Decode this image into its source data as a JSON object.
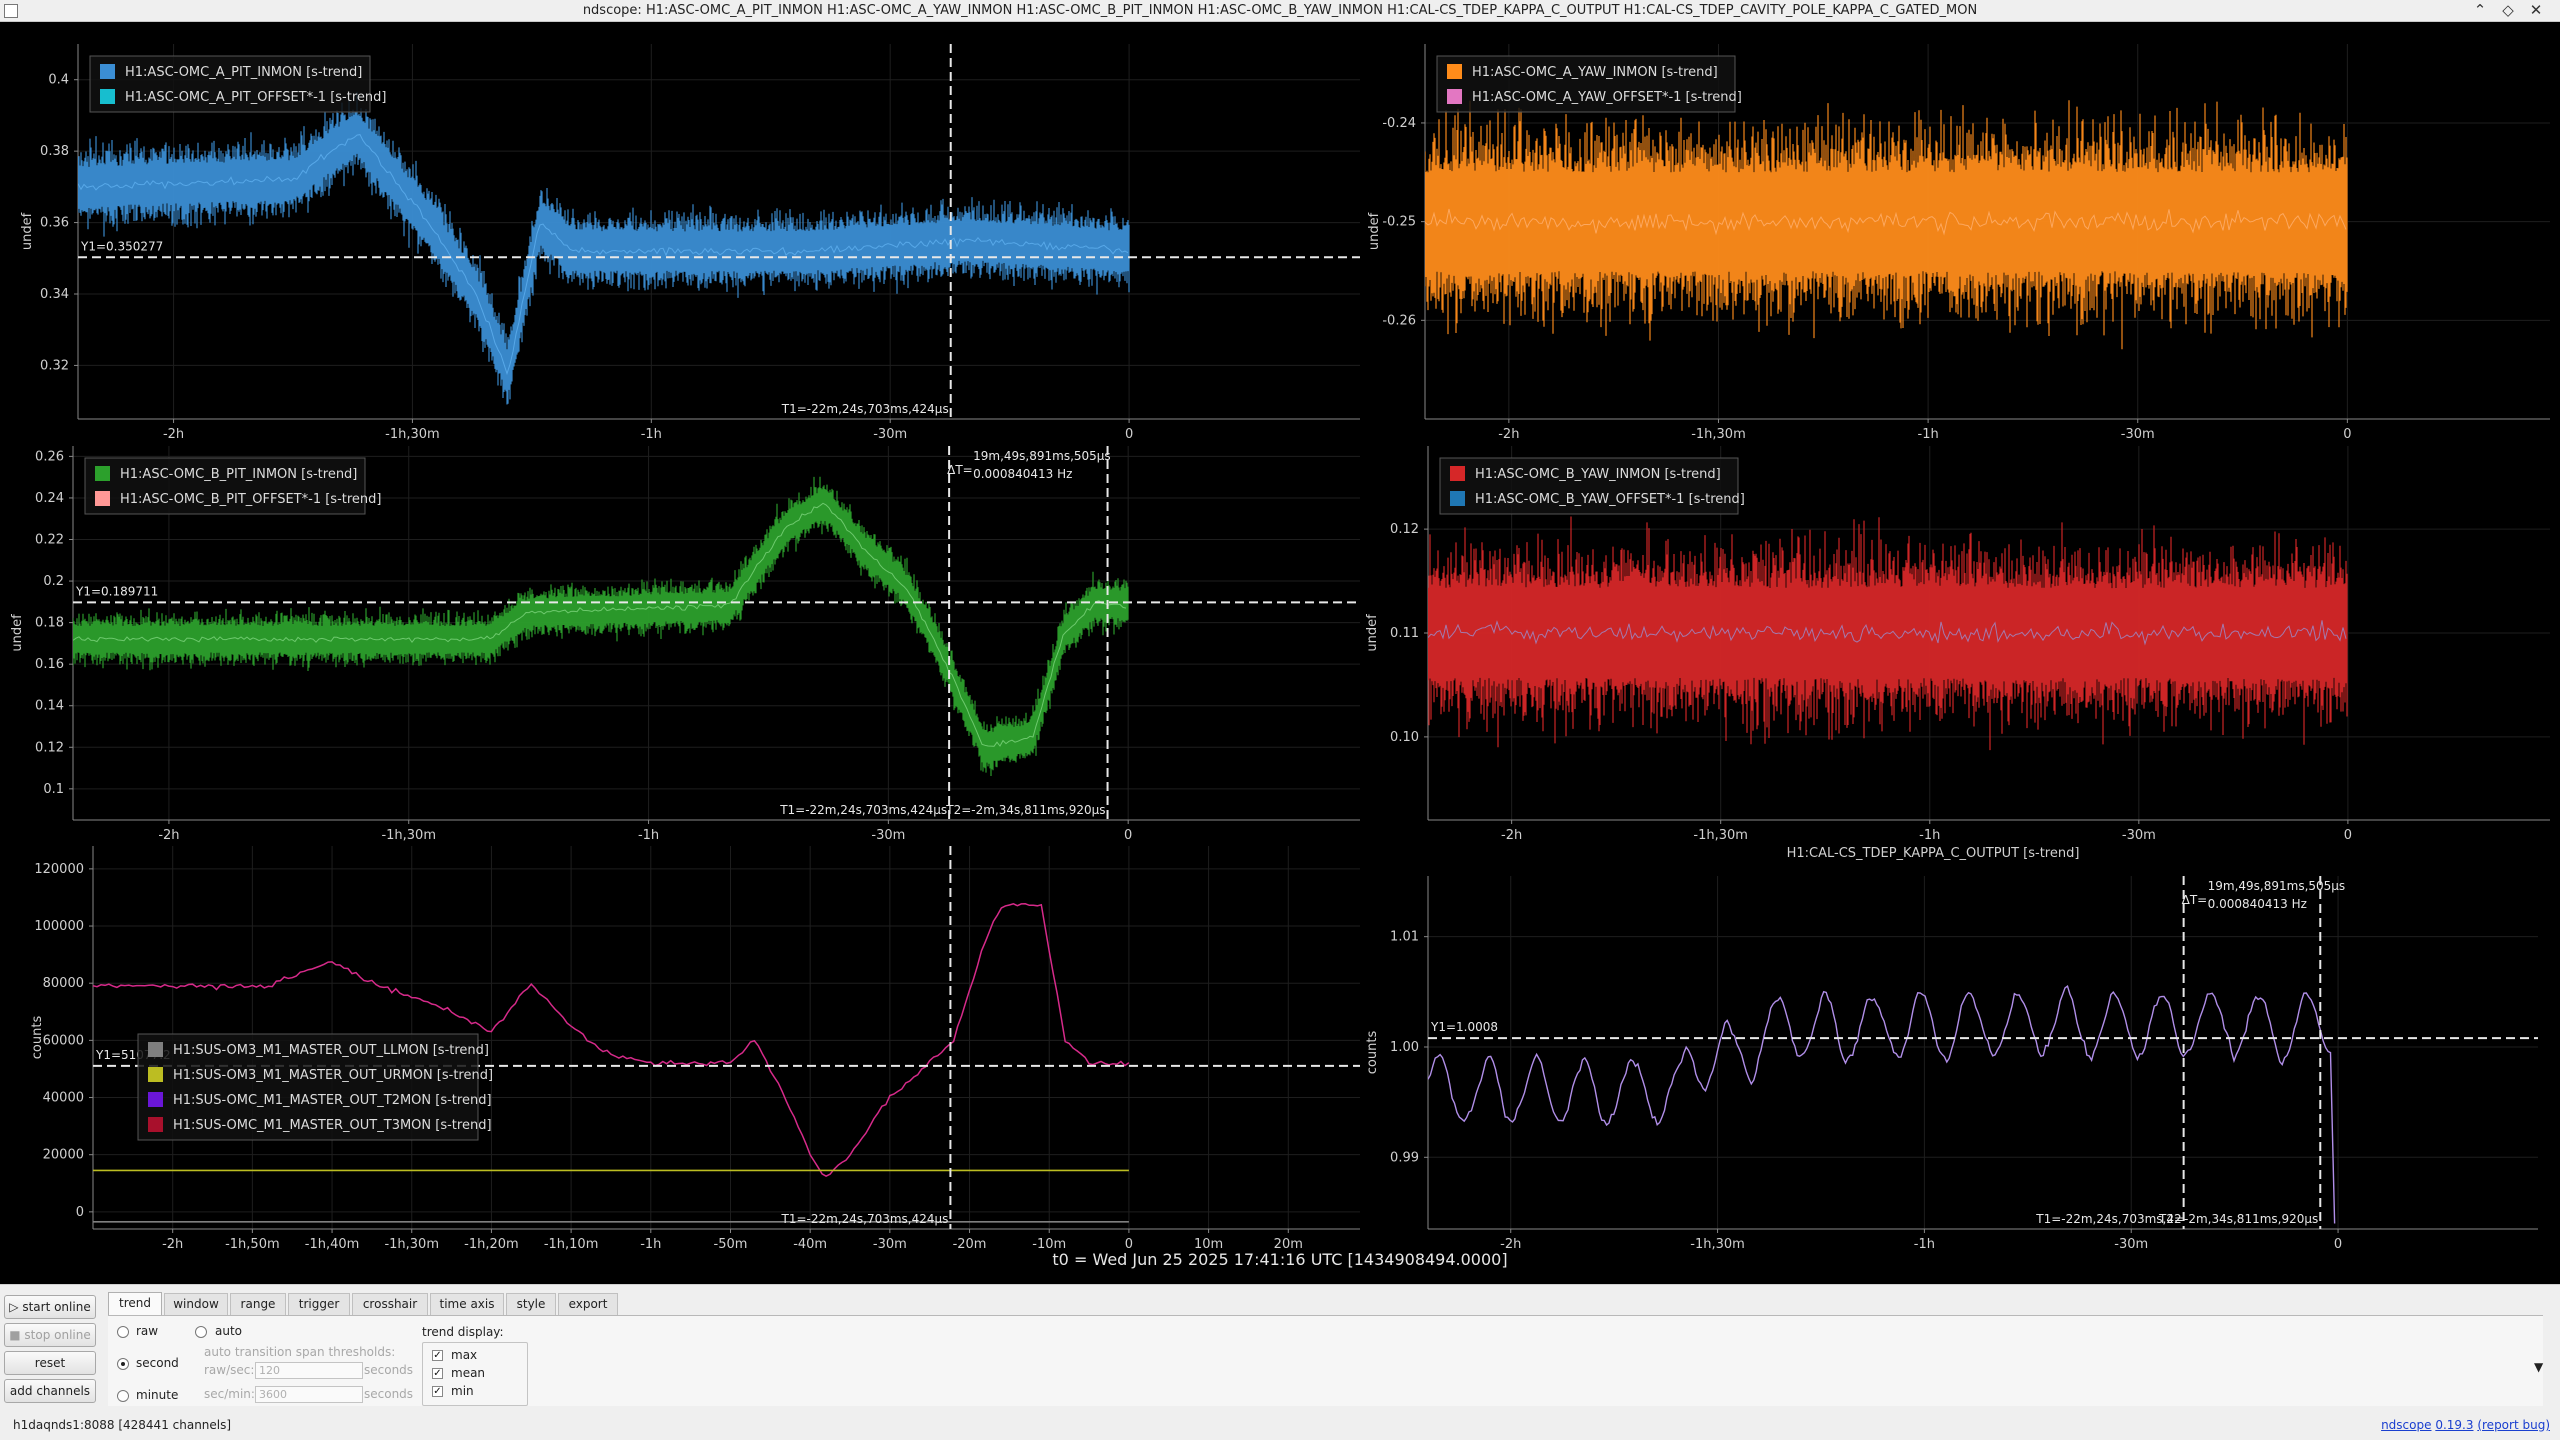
{
  "window": {
    "title": "ndscope: H1:ASC-OMC_A_PIT_INMON H1:ASC-OMC_A_YAW_INMON H1:ASC-OMC_B_PIT_INMON H1:ASC-OMC_B_YAW_INMON H1:CAL-CS_TDEP_KAPPA_C_OUTPUT H1:CAL-CS_TDEP_CAVITY_POLE_KAPPA_C_GATED_MON"
  },
  "colors": {
    "blue": "#3b8ed4",
    "cyan": "#17becf",
    "orange": "#ff8c1a",
    "pink": "#e377c2",
    "green": "#2ca02c",
    "salmon": "#ff9896",
    "red": "#d62728",
    "steelblue": "#1f77b4",
    "gray": "#7f7f7f",
    "olive": "#bcbd22",
    "purple": "#6a16d8",
    "crimson": "#a8102c",
    "lavender": "#b08ee8",
    "magenta": "#d62a8a"
  },
  "plots": [
    {
      "id": "a-pit",
      "ylabel": "undef",
      "yticks": [
        "0.4",
        "0.38",
        "0.36",
        "0.34",
        "0.32"
      ],
      "ytick_vals": [
        0.4,
        0.38,
        0.36,
        0.34,
        0.32
      ],
      "ylim": [
        0.305,
        0.41
      ],
      "xticks": [
        "-2h",
        "-1h,30m",
        "-1h",
        "-30m",
        "0"
      ],
      "xtick_vals": [
        -120,
        -90,
        -60,
        -30,
        0
      ],
      "xlim": [
        -132,
        29
      ],
      "legend": [
        {
          "name": "H1:ASC-OMC_A_PIT_INMON [s-trend]",
          "color": "#3b8ed4"
        },
        {
          "name": "H1:ASC-OMC_A_PIT_OFFSET*-1 [s-trend]",
          "color": "#17becf"
        }
      ],
      "y1": {
        "label": "Y1=0.350277",
        "value": 0.350277
      },
      "t1": {
        "label": "T1=-22m,24s,703ms,424µs",
        "value": -22.4
      }
    },
    {
      "id": "a-yaw",
      "ylabel": "undef",
      "yticks": [
        "-0.24",
        "-0.25",
        "-0.26"
      ],
      "ytick_vals": [
        -0.24,
        -0.25,
        -0.26
      ],
      "ylim": [
        -0.27,
        -0.232
      ],
      "xticks": [
        "-2h",
        "-1h,30m",
        "-1h",
        "-30m",
        "0"
      ],
      "xtick_vals": [
        -120,
        -90,
        -60,
        -30,
        0
      ],
      "xlim": [
        -132,
        29
      ],
      "legend": [
        {
          "name": "H1:ASC-OMC_A_YAW_INMON [s-trend]",
          "color": "#ff8c1a"
        },
        {
          "name": "H1:ASC-OMC_A_YAW_OFFSET*-1 [s-trend]",
          "color": "#e377c2"
        }
      ]
    },
    {
      "id": "b-pit",
      "ylabel": "undef",
      "yticks": [
        "0.26",
        "0.24",
        "0.22",
        "0.2",
        "0.18",
        "0.16",
        "0.14",
        "0.12",
        "0.1"
      ],
      "ytick_vals": [
        0.26,
        0.24,
        0.22,
        0.2,
        0.18,
        0.16,
        0.14,
        0.12,
        0.1
      ],
      "ylim": [
        0.085,
        0.265
      ],
      "xticks": [
        "-2h",
        "-1h,30m",
        "-1h",
        "-30m",
        "0"
      ],
      "xtick_vals": [
        -120,
        -90,
        -60,
        -30,
        0
      ],
      "xlim": [
        -132,
        29
      ],
      "legend": [
        {
          "name": "H1:ASC-OMC_B_PIT_INMON [s-trend]",
          "color": "#2ca02c"
        },
        {
          "name": "H1:ASC-OMC_B_PIT_OFFSET*-1 [s-trend]",
          "color": "#ff9896"
        }
      ],
      "y1": {
        "label": "Y1=0.189711",
        "value": 0.189711
      },
      "t1": {
        "label": "T1=-22m,24s,703ms,424µs",
        "value": -22.4
      },
      "t2": {
        "label": "T2=-2m,34s,811ms,920µs",
        "value": -2.58
      },
      "delta": {
        "label": "ΔT=",
        "value": "19m,49s,891ms,505µs",
        "freq": "0.000840413 Hz"
      }
    },
    {
      "id": "b-yaw",
      "ylabel": "undef",
      "yticks": [
        "0.12",
        "0.11",
        "0.10"
      ],
      "ytick_vals": [
        0.12,
        0.11,
        0.1
      ],
      "ylim": [
        0.092,
        0.128
      ],
      "xticks": [
        "-2h",
        "-1h,30m",
        "-1h",
        "-30m",
        "0"
      ],
      "xtick_vals": [
        -120,
        -90,
        -60,
        -30,
        0
      ],
      "xlim": [
        -132,
        29
      ],
      "legend": [
        {
          "name": "H1:ASC-OMC_B_YAW_INMON [s-trend]",
          "color": "#d62728"
        },
        {
          "name": "H1:ASC-OMC_B_YAW_OFFSET*-1 [s-trend]",
          "color": "#1f77b4"
        }
      ]
    },
    {
      "id": "sus",
      "ylabel": "counts",
      "yticks": [
        "120000",
        "100000",
        "80000",
        "60000",
        "40000",
        "20000",
        "0"
      ],
      "ytick_vals": [
        120000,
        100000,
        80000,
        60000,
        40000,
        20000,
        0
      ],
      "ylim": [
        -6000,
        128000
      ],
      "xticks": [
        "-2h",
        "-1h,50m",
        "-1h,40m",
        "-1h,30m",
        "-1h,20m",
        "-1h,10m",
        "-1h",
        "-50m",
        "-40m",
        "-30m",
        "-20m",
        "-10m",
        "0",
        "10m",
        "20m"
      ],
      "xtick_vals": [
        -120,
        -110,
        -100,
        -90,
        -80,
        -70,
        -60,
        -50,
        -40,
        -30,
        -20,
        -10,
        0,
        10,
        20
      ],
      "xlim": [
        -130,
        29
      ],
      "legend": [
        {
          "name": "H1:SUS-OM3_M1_MASTER_OUT_LLMON [s-trend]",
          "color": "#7f7f7f"
        },
        {
          "name": "H1:SUS-OM3_M1_MASTER_OUT_URMON [s-trend]",
          "color": "#bcbd22"
        },
        {
          "name": "H1:SUS-OMC_M1_MASTER_OUT_T2MON [s-trend]",
          "color": "#6a16d8"
        },
        {
          "name": "H1:SUS-OMC_M1_MASTER_OUT_T3MON [s-trend]",
          "color": "#a8102c"
        }
      ],
      "y1": {
        "label": "Y1=51077.2",
        "value": 51077.2
      },
      "t1": {
        "label": "T1=-22m,24s,703ms,424µs",
        "value": -22.4
      }
    },
    {
      "id": "kappa",
      "title": "H1:CAL-CS_TDEP_KAPPA_C_OUTPUT [s-trend]",
      "ylabel": "counts",
      "yticks": [
        "1.01",
        "1.00",
        "0.99"
      ],
      "ytick_vals": [
        1.01,
        1.0,
        0.99
      ],
      "ylim": [
        0.9835,
        1.0155
      ],
      "xticks": [
        "-2h",
        "-1h,30m",
        "-1h",
        "-30m",
        "0"
      ],
      "xtick_vals": [
        -120,
        -90,
        -60,
        -30,
        0
      ],
      "xlim": [
        -132,
        29
      ],
      "y1": {
        "label": "Y1=1.0008",
        "value": 1.0008
      },
      "t1": {
        "label": "T1=-22m,24s,703ms,42",
        "value": -22.4
      },
      "t2": {
        "label": "T2=-2m,34s,811ms,920µs",
        "value": -2.58
      },
      "delta": {
        "label": "ΔT=",
        "value": "19m,49s,891ms,505µs",
        "freq": "0.000840413 Hz"
      }
    }
  ],
  "t0": "t0 = Wed Jun 25 2025 17:41:16 UTC [1434908494.0000]",
  "controls": {
    "buttons": {
      "start": "start online",
      "stop": "stop online",
      "reset": "reset",
      "add": "add channels"
    },
    "tabs": [
      "trend",
      "window",
      "range",
      "trigger",
      "crosshair",
      "time axis",
      "style",
      "export"
    ],
    "trend": {
      "raw": "raw",
      "auto": "auto",
      "second": "second",
      "minute": "minute",
      "thresholds": "auto transition span thresholds:",
      "rawsec": "raw/sec:",
      "rawsec_val": "120",
      "secmin": "sec/min:",
      "secmin_val": "3600",
      "seconds": "seconds",
      "display": "trend display:",
      "max": "max",
      "mean": "mean",
      "min": "min"
    },
    "dropdown": "▼"
  },
  "status": {
    "server": "h1daqnds1:8088  [428441 channels]",
    "app": "ndscope",
    "version": "0.19.3",
    "report": "(report bug)"
  }
}
